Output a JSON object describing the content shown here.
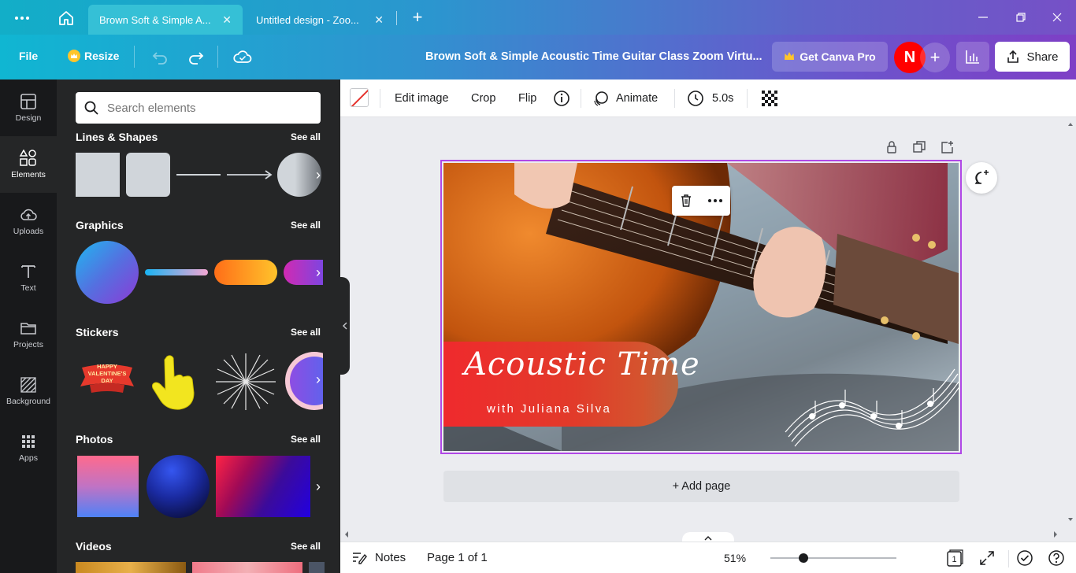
{
  "tabs": [
    {
      "label": "Brown Soft & Simple A...",
      "active": true
    },
    {
      "label": "Untitled design - Zoo...",
      "active": false
    }
  ],
  "header": {
    "file_label": "File",
    "resize_label": "Resize",
    "doc_title": "Brown Soft & Simple Acoustic Time Guitar Class Zoom Virtu...",
    "get_pro_label": "Get Canva Pro",
    "avatar_initial": "N",
    "share_label": "Share"
  },
  "rail": [
    {
      "label": "Design",
      "icon": "layout-icon"
    },
    {
      "label": "Elements",
      "icon": "shapes-icon",
      "active": true
    },
    {
      "label": "Uploads",
      "icon": "cloud-upload-icon"
    },
    {
      "label": "Text",
      "icon": "text-icon"
    },
    {
      "label": "Projects",
      "icon": "folder-icon"
    },
    {
      "label": "Background",
      "icon": "hatch-icon"
    },
    {
      "label": "Apps",
      "icon": "grid-icon"
    }
  ],
  "panel": {
    "search_placeholder": "Search elements",
    "see_all": "See all",
    "sections": [
      "Lines & Shapes",
      "Graphics",
      "Stickers",
      "Photos",
      "Videos"
    ],
    "sticker_text": "HAPPY VALENTINE'S DAY"
  },
  "toolbar": {
    "edit_image": "Edit image",
    "crop": "Crop",
    "flip": "Flip",
    "animate": "Animate",
    "duration": "5.0s"
  },
  "design": {
    "title": "Acoustic Time",
    "subtitle": "with Juliana Silva"
  },
  "add_page": "+ Add page",
  "footer": {
    "notes": "Notes",
    "page_indicator": "Page 1 of 1",
    "zoom": "51%",
    "zoom_fraction": 0.51,
    "page_count": "1"
  },
  "colors": {
    "accent": "#8b3dff",
    "avatar": "#ff0000",
    "crown": "#ffc52b"
  }
}
